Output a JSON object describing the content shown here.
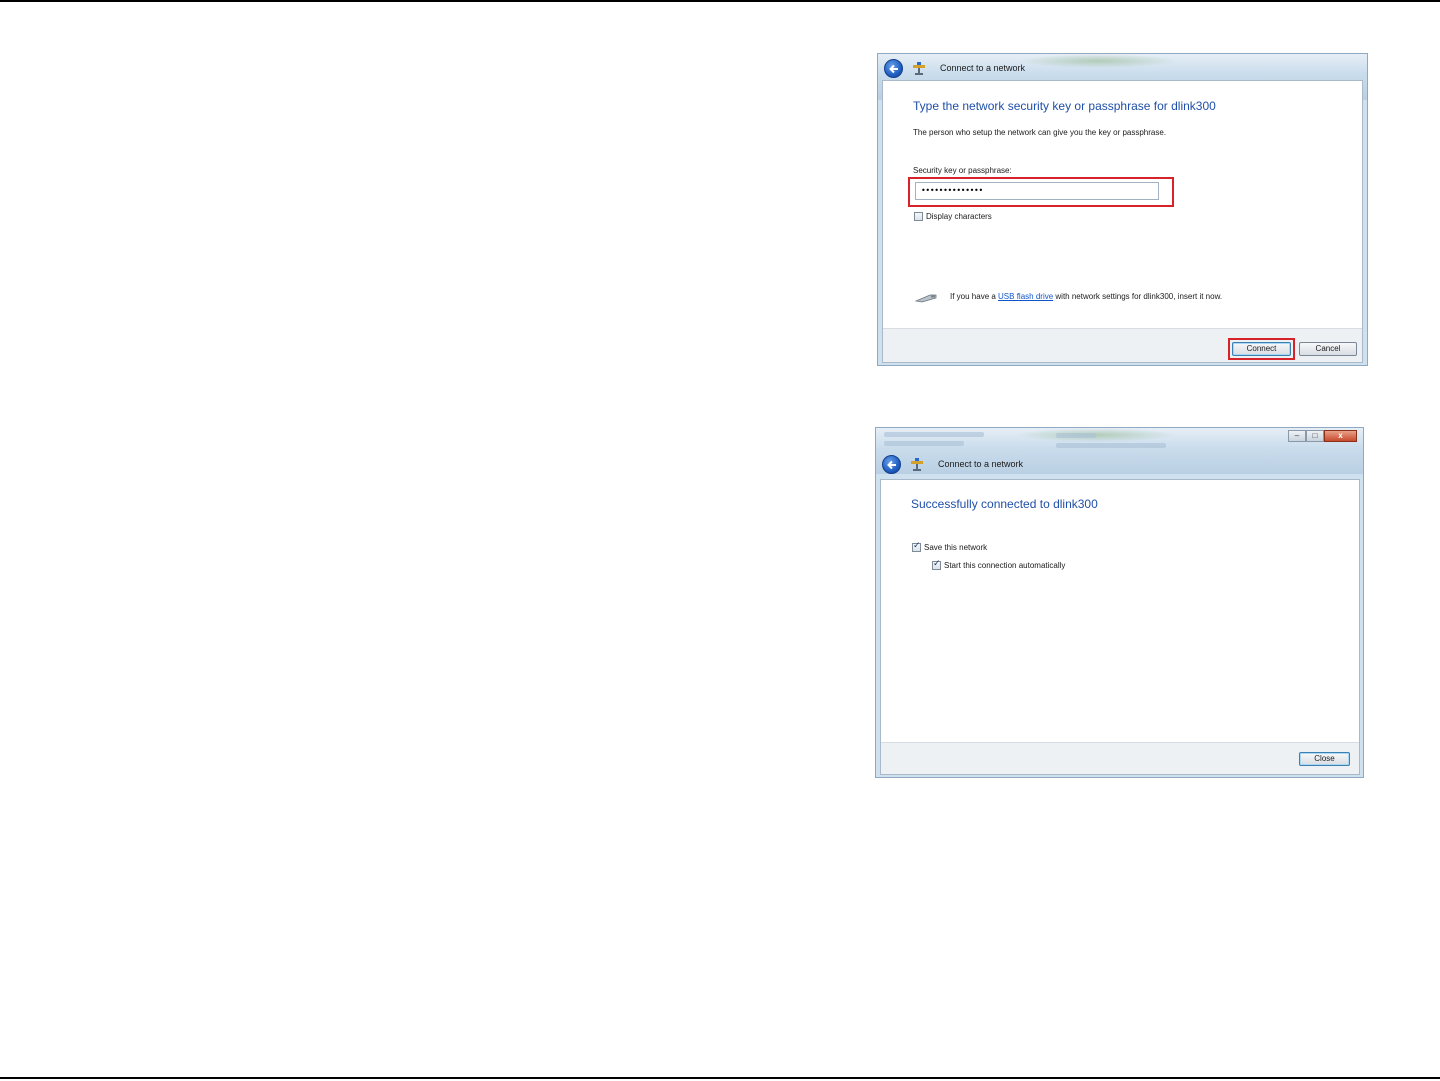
{
  "dialog1": {
    "title": "Connect to a network",
    "heading": "Type the network security key or passphrase for dlink300",
    "description": "The person who setup the network can give you the key or passphrase.",
    "field_label": "Security key or passphrase:",
    "field_value": "••••••••••••••",
    "display_characters_label": "Display characters",
    "usb_prefix": "If you have a ",
    "usb_link": "USB flash drive",
    "usb_suffix": " with network settings for dlink300, insert it now.",
    "connect_label": "Connect",
    "cancel_label": "Cancel"
  },
  "dialog2": {
    "title": "Connect to a network",
    "heading": "Successfully connected to dlink300",
    "save_network_label": "Save this network",
    "start_auto_label": "Start this connection automatically",
    "close_label": "Close",
    "minimize_glyph": "–",
    "maximize_glyph": "□",
    "close_glyph": "x"
  },
  "colors": {
    "heading": "#1f4fa8",
    "highlight": "#d6232a",
    "link": "#1155cc"
  }
}
